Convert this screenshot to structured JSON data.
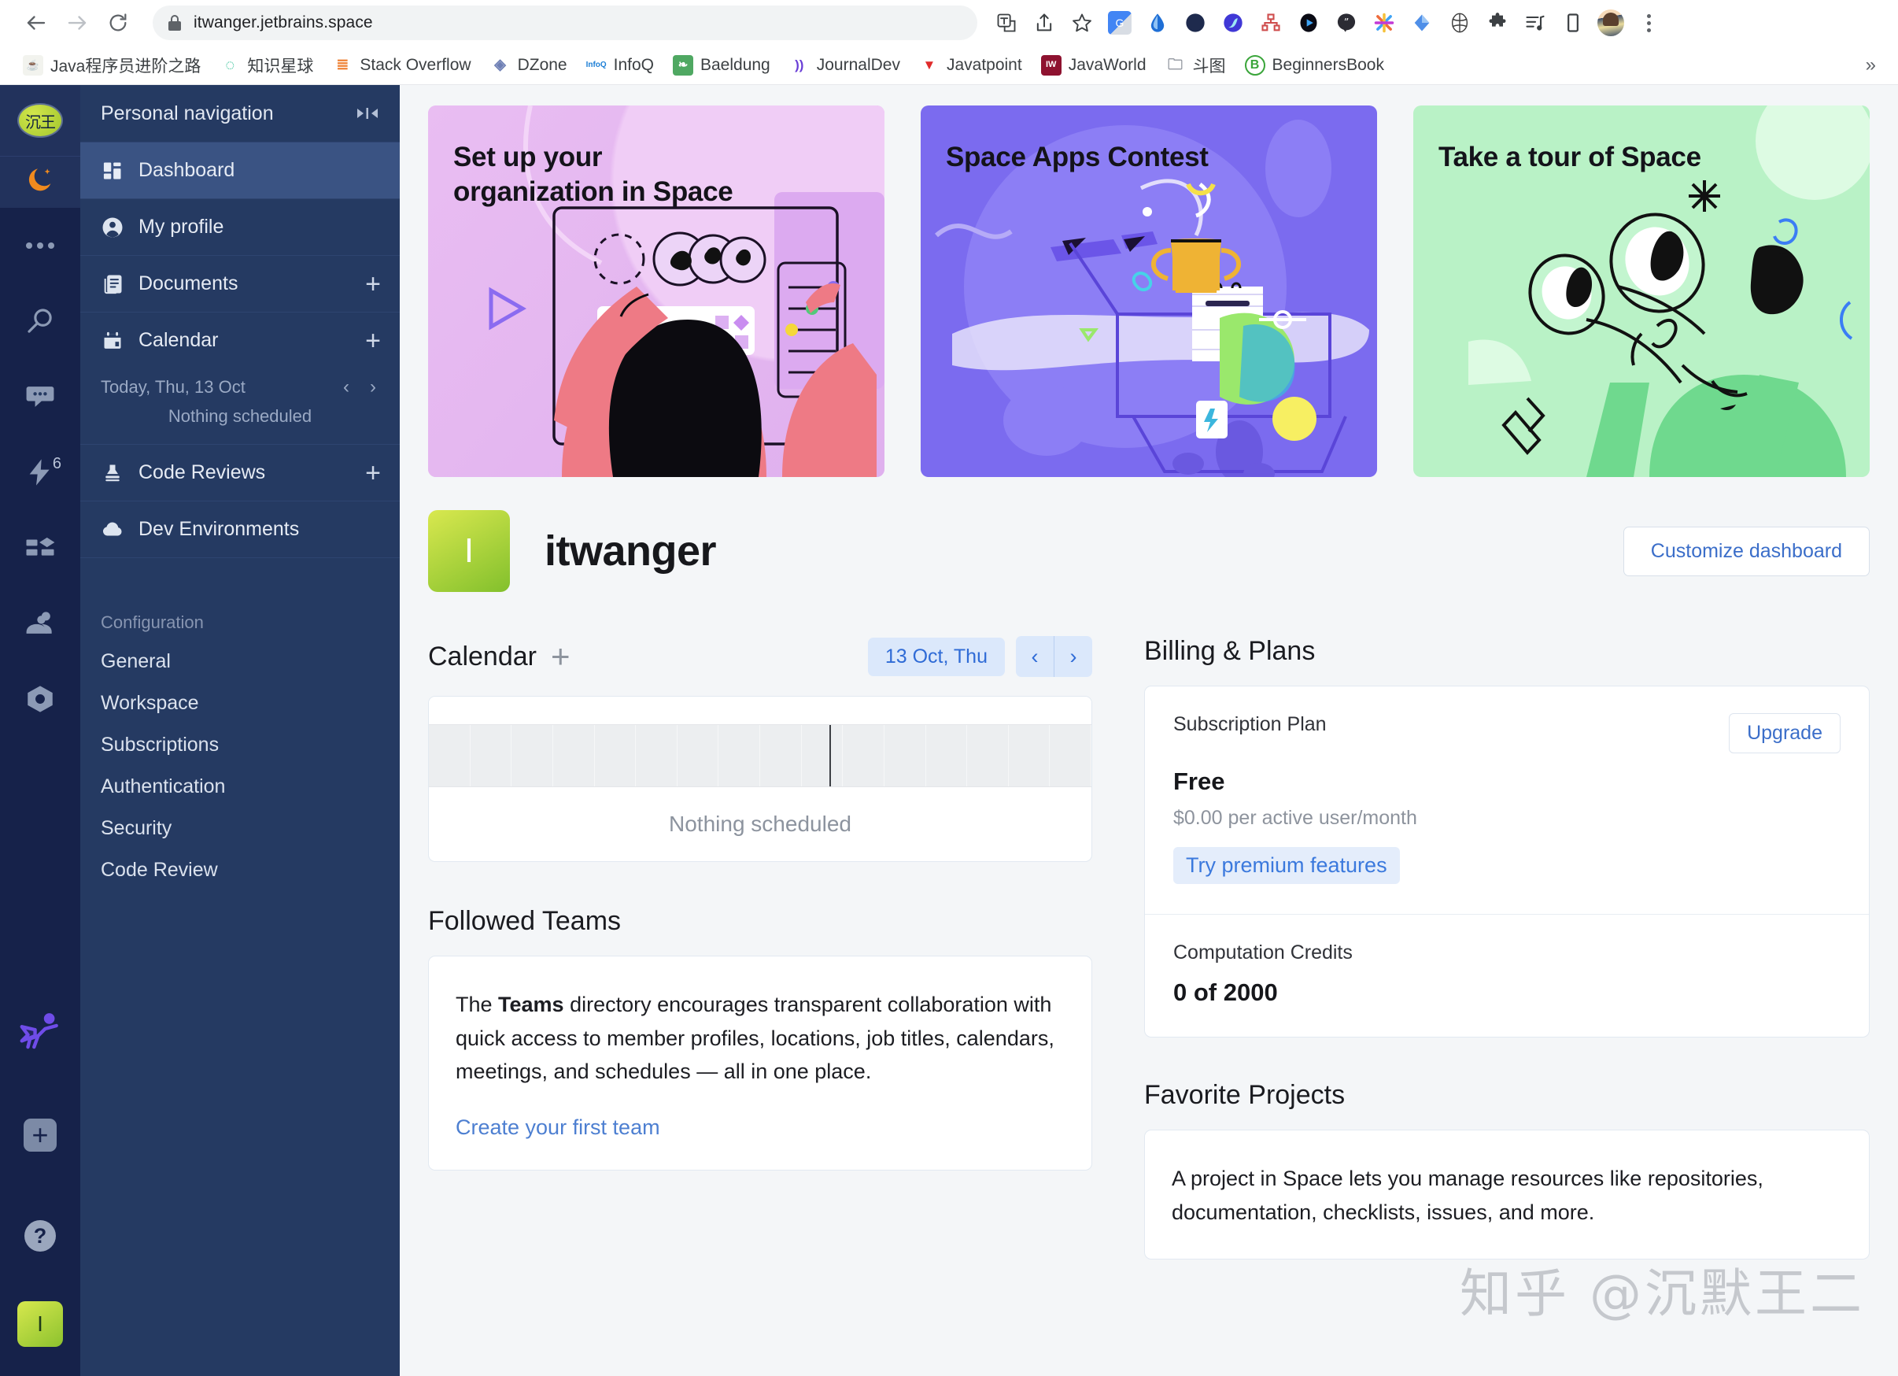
{
  "browser": {
    "back_icon": "back-arrow-icon",
    "forward_icon": "forward-arrow-icon",
    "reload_icon": "reload-icon",
    "url": "itwanger.jetbrains.space",
    "lock_icon": "lock-icon",
    "actions": [
      "translate-icon",
      "share-icon",
      "bookmark-star-icon"
    ],
    "extensions": [
      {
        "name": "google-translate-extension",
        "glyph": "G",
        "color": "#3b7ddd"
      },
      {
        "name": "water-drop-extension",
        "glyph": "",
        "color": "#1f6fd6"
      },
      {
        "name": "moon-extension",
        "glyph": "",
        "color": "#2c3f7a"
      },
      {
        "name": "wave-extension",
        "glyph": "",
        "color": "#4038d6"
      },
      {
        "name": "sitemap-extension",
        "glyph": "",
        "color": "#cf4d4d"
      },
      {
        "name": "play-extension",
        "glyph": "",
        "color": "#0a0a14"
      },
      {
        "name": "quote-extension",
        "glyph": "",
        "color": "#2b2b33"
      },
      {
        "name": "colorful-star-extension",
        "glyph": "",
        "color": "#ef6c3c"
      },
      {
        "name": "diamond-extension",
        "glyph": "",
        "color": "#4f8fe8"
      },
      {
        "name": "spider-extension",
        "glyph": "",
        "color": "#3a3a3a"
      },
      {
        "name": "puzzle-extensions-icon",
        "glyph": "",
        "color": "#3c4043"
      },
      {
        "name": "playlist-extension",
        "glyph": "",
        "color": "#3c4043"
      },
      {
        "name": "device-toolbar-icon",
        "glyph": "",
        "color": "#3c4043"
      }
    ],
    "profile_icon": "chrome-profile-avatar",
    "menu_icon": "kebab-menu-icon"
  },
  "bookmarks": {
    "items": [
      {
        "label": "Java程序员进阶之路",
        "icon": "java-bookmark-icon",
        "color": "#f2f3ee",
        "glyph": "☕",
        "fg": "#3b6e3b"
      },
      {
        "label": "知识星球",
        "icon": "zsxq-bookmark-icon",
        "color": "#ffffff",
        "glyph": "◯",
        "fg": "#19b98a"
      },
      {
        "label": "Stack Overflow",
        "icon": "stackoverflow-bookmark-icon",
        "color": "#ffffff",
        "glyph": "▤",
        "fg": "#ef8236"
      },
      {
        "label": "DZone",
        "icon": "dzone-bookmark-icon",
        "color": "#ffffff",
        "glyph": "◈",
        "fg": "#6e7fb5"
      },
      {
        "label": "InfoQ",
        "icon": "infoq-bookmark-icon",
        "color": "#ffffff",
        "glyph": "IQ",
        "fg": "#1d7fd6"
      },
      {
        "label": "Baeldung",
        "icon": "baeldung-bookmark-icon",
        "color": "#4fa862",
        "glyph": "🌿",
        "fg": "#ffffff"
      },
      {
        "label": "JournalDev",
        "icon": "journaldev-bookmark-icon",
        "color": "#ffffff",
        "glyph": "))",
        "fg": "#6a3fd6"
      },
      {
        "label": "Javatpoint",
        "icon": "javatpoint-bookmark-icon",
        "color": "#ffffff",
        "glyph": "▼",
        "fg": "#e02b2b"
      },
      {
        "label": "JavaWorld",
        "icon": "javaworld-bookmark-icon",
        "color": "#8e1230",
        "glyph": "IW",
        "fg": "#ffffff"
      },
      {
        "label": "斗图",
        "icon": "doutu-bookmark-icon",
        "color": "#ffffff",
        "glyph": "🗀",
        "fg": "#8a8f98"
      },
      {
        "label": "BeginnersBook",
        "icon": "beginnersbook-bookmark-icon",
        "color": "#ffffff",
        "glyph": "B",
        "fg": "#3aa53a"
      }
    ],
    "overflow_label": "»"
  },
  "rail": {
    "org_avatar_text": "沉王",
    "moon_icon": "moon-theme-icon",
    "items": [
      {
        "name": "more-dots-icon",
        "badge": ""
      },
      {
        "name": "search-icon",
        "badge": ""
      },
      {
        "name": "chat-icon",
        "badge": ""
      },
      {
        "name": "automation-bolt-icon",
        "badge": "6"
      },
      {
        "name": "packages-icon",
        "badge": ""
      },
      {
        "name": "teams-icon",
        "badge": ""
      },
      {
        "name": "settings-hex-icon",
        "badge": ""
      }
    ],
    "hero_icon": "superhero-icon",
    "plus_label": "+",
    "help_label": "?",
    "user_initial": "I"
  },
  "sidebar": {
    "title": "Personal navigation",
    "collapse_icon": "collapse-panel-icon",
    "items": [
      {
        "label": "Dashboard",
        "icon": "dashboard-icon",
        "active": true,
        "plus": false
      },
      {
        "label": "My profile",
        "icon": "person-icon",
        "active": false,
        "plus": false
      },
      {
        "label": "Documents",
        "icon": "documents-icon",
        "active": false,
        "plus": true
      },
      {
        "label": "Calendar",
        "icon": "calendar-icon",
        "active": false,
        "plus": true
      }
    ],
    "today_label": "Today, Thu, 13 Oct",
    "prev_icon": "chevron-left-icon",
    "next_icon": "chevron-right-icon",
    "nothing_scheduled": "Nothing scheduled",
    "items2": [
      {
        "label": "Code Reviews",
        "icon": "code-review-stamp-icon",
        "plus": true
      },
      {
        "label": "Dev Environments",
        "icon": "cloud-icon",
        "plus": false
      }
    ],
    "config_title": "Configuration",
    "config_links": [
      {
        "label": "General"
      },
      {
        "label": "Workspace"
      },
      {
        "label": "Subscriptions"
      },
      {
        "label": "Authentication"
      },
      {
        "label": "Security"
      },
      {
        "label": "Code Review"
      }
    ]
  },
  "banners": [
    {
      "title": "Set up your\norganization in Space",
      "key": "setup-organization-banner"
    },
    {
      "title": "Space Apps Contest",
      "key": "space-apps-contest-banner"
    },
    {
      "title": "Take a tour of Space",
      "key": "take-a-tour-banner"
    }
  ],
  "profile": {
    "initial": "I",
    "name": "itwanger",
    "customize_label": "Customize dashboard"
  },
  "calendar": {
    "title": "Calendar",
    "add_icon": "plus-icon",
    "date_label": "13 Oct, Thu",
    "prev_icon": "chevron-left-icon",
    "next_icon": "chevron-right-icon",
    "empty_label": "Nothing scheduled"
  },
  "teams": {
    "title": "Followed Teams",
    "text_a": "The ",
    "text_b": "Teams",
    "text_c": " directory encourages transparent collaboration with quick access to member profiles, locations, job titles, calendars, meetings, and schedules — all in one place.",
    "link": "Create your first team"
  },
  "billing": {
    "title": "Billing & Plans",
    "plan_label": "Subscription Plan",
    "upgrade_label": "Upgrade",
    "plan_name": "Free",
    "plan_price": "$0.00 per active user/month",
    "premium_link": "Try premium features",
    "credits_label": "Computation Credits",
    "credits_value": "0 of 2000"
  },
  "projects": {
    "title": "Favorite Projects",
    "text": "A project in Space lets you manage resources like repositories, documentation, checklists, issues, and more."
  },
  "watermark": "知乎 @沉默王二",
  "colors": {
    "rail_bg": "#16224a",
    "sidebar_bg": "#253a62",
    "sidebar_active": "#3a5383",
    "main_bg": "#f4f6f8",
    "accent_blue": "#3b6ec9",
    "banner_pink": "#e6b9f0",
    "banner_purple": "#7b6bef",
    "banner_green": "#b9f2c6",
    "avatar_green": "#9ccd34"
  }
}
